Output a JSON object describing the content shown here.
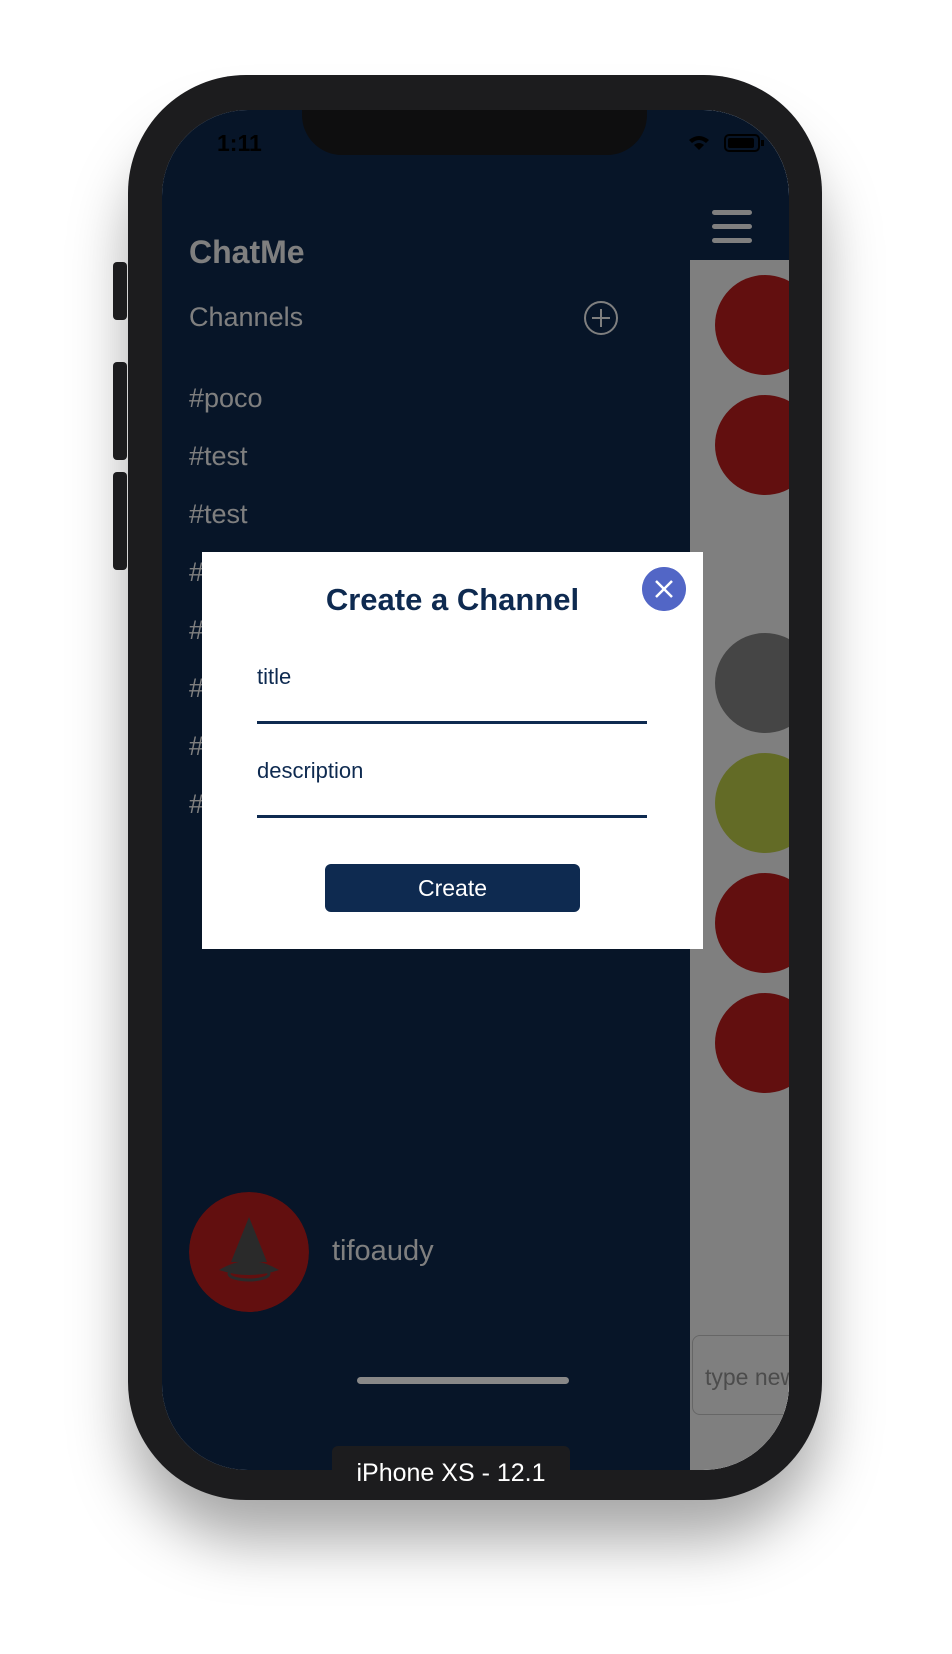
{
  "status_bar": {
    "time": "1:11"
  },
  "sidebar": {
    "app_title": "ChatMe",
    "channels_label": "Channels",
    "channels": [
      "#poco",
      "#test",
      "#test",
      "#p",
      "#p",
      "#a",
      "#j",
      "#R"
    ],
    "user": {
      "username": "tifoaudy"
    }
  },
  "chat_pane": {
    "input_placeholder": "type new"
  },
  "modal": {
    "title": "Create a Channel",
    "title_field_placeholder": "title",
    "description_field_placeholder": "description",
    "create_button_label": "Create"
  },
  "device_label": "iPhone XS - 12.1",
  "colors": {
    "navy": "#0e2a50",
    "accent": "#5266c6",
    "avatar_red": "#c41e1e",
    "avatar_yellow": "#c7d64c"
  },
  "icons": [
    "plus-circle-icon",
    "close-icon",
    "hamburger-menu-icon",
    "wifi-icon",
    "battery-icon",
    "shark-avatar-icon"
  ]
}
